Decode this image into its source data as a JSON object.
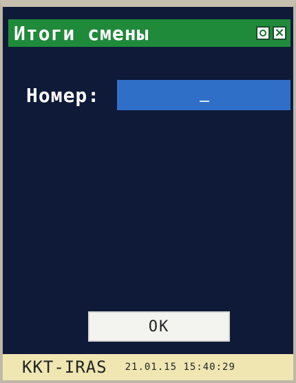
{
  "window": {
    "title": "Итоги смены",
    "controls": {
      "ok_icon": "ok-circle-icon",
      "close_icon": "close-x-icon"
    }
  },
  "form": {
    "label": "Номер:",
    "value": ""
  },
  "actions": {
    "ok_label": "OK"
  },
  "status": {
    "device": "KKT-IRAS",
    "date": "21.01.15",
    "time": "15:40:29"
  },
  "colors": {
    "titlebar": "#1f8a3a",
    "background": "#0f1a38",
    "input": "#2f6fc8",
    "statusbar": "#efe6b2"
  }
}
